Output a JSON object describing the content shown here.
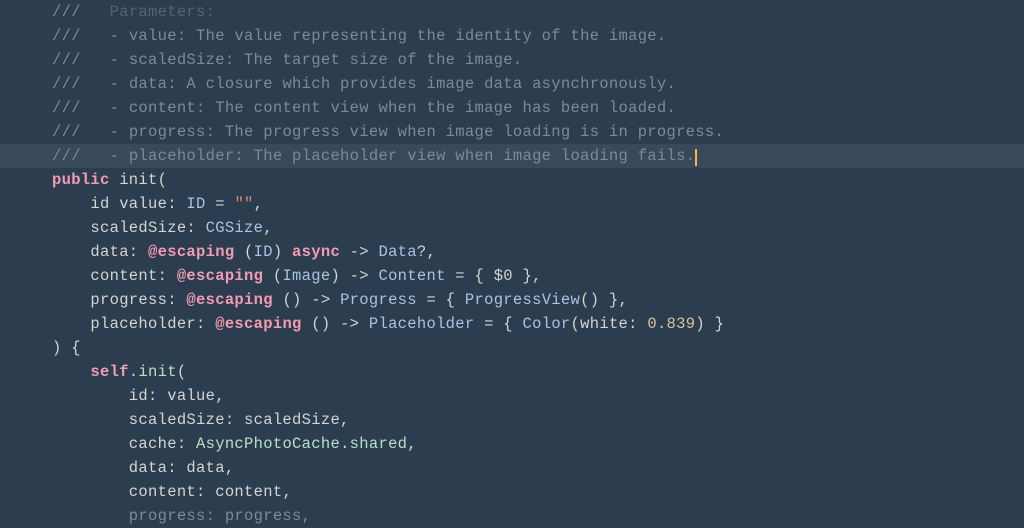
{
  "lines": {
    "l0_slashes": "///",
    "l0_marker": "Parameters:",
    "l1_slashes": "///",
    "l1_rest": "   - value: The value representing the identity of the image.",
    "l2_slashes": "///",
    "l2_rest": "   - scaledSize: The target size of the image.",
    "l3_slashes": "///",
    "l3_rest": "   - data: A closure which provides image data asynchronously.",
    "l4_slashes": "///",
    "l4_rest": "   - content: The content view when the image has been loaded.",
    "l5_slashes": "///",
    "l5_rest": "   - progress: The progress view when image loading is in progress.",
    "l6_slashes": "///",
    "l6_rest": "   - placeholder: The placeholder view when image loading fails.",
    "l7_public": "public",
    "l7_init": " init",
    "l7_paren": "(",
    "l8_id": "    id",
    "l8_value": " value: ",
    "l8_type": "ID",
    "l8_eq": " = ",
    "l8_str": "\"\"",
    "l8_comma": ",",
    "l9_label": "    scaledSize: ",
    "l9_type": "CGSize",
    "l9_comma": ",",
    "l10_label": "    data: ",
    "l10_at": "@escaping",
    "l10_paren1": " (",
    "l10_idtype": "ID",
    "l10_paren2": ") ",
    "l10_async": "async",
    "l10_arrow": " -> ",
    "l10_datatype": "Data",
    "l10_opt": "?,",
    "l11_label": "    content: ",
    "l11_at": "@escaping",
    "l11_paren1": " (",
    "l11_imgtype": "Image",
    "l11_paren2": ") -> ",
    "l11_contenttype": "Content",
    "l11_eq": " = { $0 },",
    "l12_label": "    progress: ",
    "l12_at": "@escaping",
    "l12_parens": " () -> ",
    "l12_progtype": "Progress",
    "l12_eq": " = { ",
    "l12_progview": "ProgressView",
    "l12_call": "() },",
    "l13_label": "    placeholder: ",
    "l13_at": "@escaping",
    "l13_parens": " () -> ",
    "l13_phtype": "Placeholder",
    "l13_eq": " = { ",
    "l13_color": "Color",
    "l13_paren1": "(",
    "l13_white": "white",
    "l13_colon": ": ",
    "l13_num": "0.839",
    "l13_paren2": ") }",
    "l14_close": ") {",
    "l15_self": "    self",
    "l15_dot": ".",
    "l15_init": "init",
    "l15_paren": "(",
    "l16_label": "        id: ",
    "l16_val": "value,",
    "l17_label": "        scaledSize: ",
    "l17_val": "scaledSize,",
    "l18_label": "        cache: ",
    "l18_type": "AsyncPhotoCache",
    "l18_dot": ".",
    "l18_shared": "shared",
    "l18_comma": ",",
    "l19_label": "        data: ",
    "l19_val": "data,",
    "l20_label": "        content: ",
    "l20_val": "content,",
    "l21_label": "        progress: ",
    "l21_val": "progress,"
  }
}
